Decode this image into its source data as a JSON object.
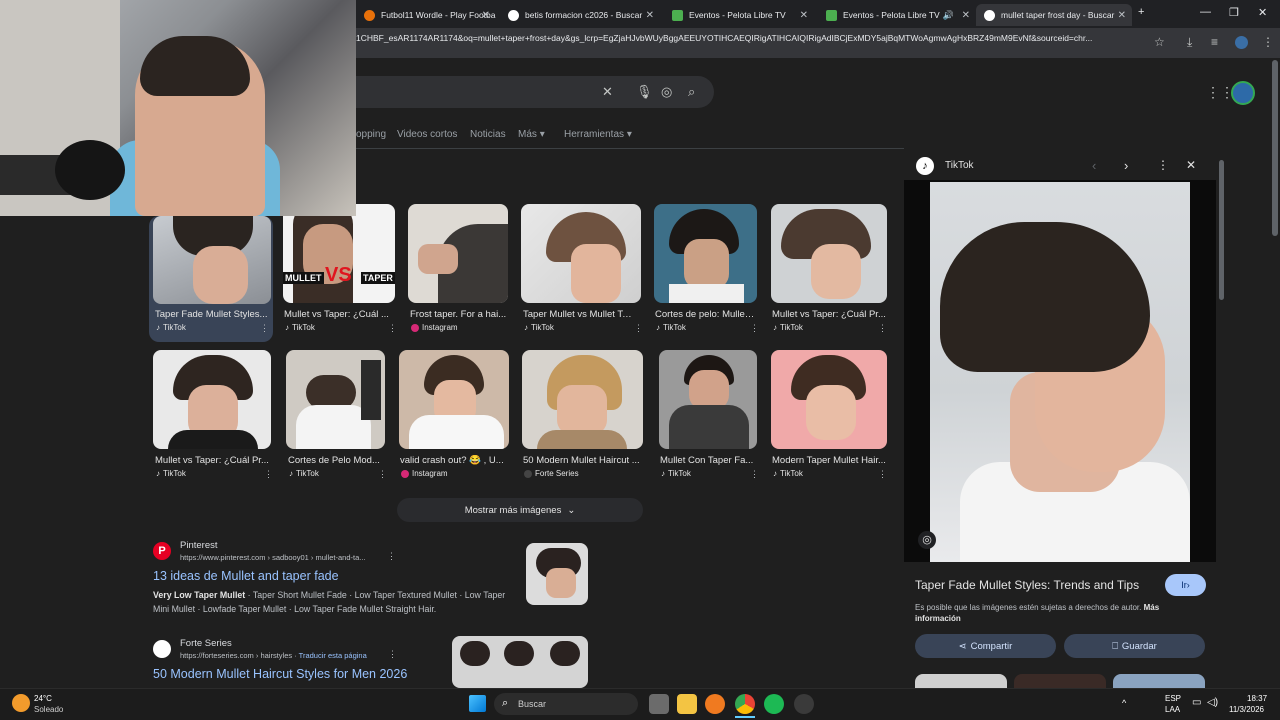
{
  "browser": {
    "tabs": [
      {
        "title": "Futbol11 Wordle - Play Footbal",
        "color": "#e8710a"
      },
      {
        "title": "betis formacion c2026 - Buscar",
        "color": "#ffffff"
      },
      {
        "title": "Eventos - Pelota Libre TV",
        "color": "#4caf50"
      },
      {
        "title": "Eventos - Pelota Libre TV",
        "color": "#4caf50"
      },
      {
        "title": "mullet taper frost day - Buscar",
        "color": "#ffffff"
      }
    ],
    "url": "1CHBF_esAR1174AR1174&oq=mullet+taper+frost+day&gs_lcrp=EgZjaHJvbWUyBggAEEUYOTIHCAEQIRigATIHCAIQIRigAdIBCjExMDY5ajBqMTWoAgmwAgHxBRZ49mM9EvNf&sourceid=chr..."
  },
  "search": {
    "nav": [
      "opping",
      "Videos cortos",
      "Noticias",
      "Más",
      "Herramientas"
    ]
  },
  "images": [
    {
      "caption": "Taper Fade Mullet Styles...",
      "source": "TikTok",
      "src_color": "#000000"
    },
    {
      "caption": "Mullet vs Taper: ¿Cuál ...",
      "source": "TikTok",
      "src_color": "#000000",
      "overlay_left": "MULLET",
      "overlay_vs": "VS",
      "overlay_right": "TAPER"
    },
    {
      "caption": "Frost taper. For a hai...",
      "source": "Instagram",
      "src_color": "#d62976"
    },
    {
      "caption": "Taper Mullet vs Mullet Ta...",
      "source": "TikTok",
      "src_color": "#000000"
    },
    {
      "caption": "Cortes de pelo: Mullet...",
      "source": "TikTok",
      "src_color": "#000000"
    },
    {
      "caption": "Mullet vs Taper: ¿Cuál Pr...",
      "source": "TikTok",
      "src_color": "#000000"
    },
    {
      "caption": "Mullet vs Taper: ¿Cuál Pr...",
      "source": "TikTok",
      "src_color": "#000000"
    },
    {
      "caption": "Cortes de Pelo Mod...",
      "source": "TikTok",
      "src_color": "#000000"
    },
    {
      "caption": "valid crash out? 😂 , U...",
      "source": "Instagram",
      "src_color": "#d62976"
    },
    {
      "caption": "50 Modern Mullet Haircut ...",
      "source": "Forte Series",
      "src_color": "#444444"
    },
    {
      "caption": "Mullet Con Taper Fa...",
      "source": "TikTok",
      "src_color": "#000000"
    },
    {
      "caption": "Modern Taper Mullet Hair...",
      "source": "TikTok",
      "src_color": "#000000"
    }
  ],
  "more_images": "Mostrar más imágenes",
  "results": [
    {
      "site": "Pinterest",
      "url": "https://www.pinterest.com › sadbooy01 › mullet-and-ta...",
      "title": "13 ideas de Mullet and taper fade",
      "snippet_bold": "Very Low Taper Mullet",
      "snippet": " · Taper Short Mullet Fade · Low Taper Textured Mullet · Low Taper Mini Mullet · Lowfade Taper Mullet · Low Taper Fade Mullet Straight Hair.",
      "favicon_color": "#e60023"
    },
    {
      "site": "Forte Series",
      "url": "https://forteseries.com › hairstyles",
      "translate": "Traducir esta página",
      "title": "50 Modern Mullet Haircut Styles for Men 2026",
      "favicon_color": "#ffffff"
    }
  ],
  "panel": {
    "source": "TikTok",
    "title": "Taper Fade Mullet Styles: Trends and Tips",
    "visit": "Ir",
    "note": "Es posible que las imágenes estén sujetas a derechos de autor.",
    "note_link": "Más información",
    "share": "Compartir",
    "save": "Guardar"
  },
  "taskbar": {
    "temp": "24°C",
    "weather": "Soleado",
    "search": "Buscar",
    "lang1": "ESP",
    "lang2": "LAA",
    "time": "18:37",
    "date": "11/3/2026"
  }
}
